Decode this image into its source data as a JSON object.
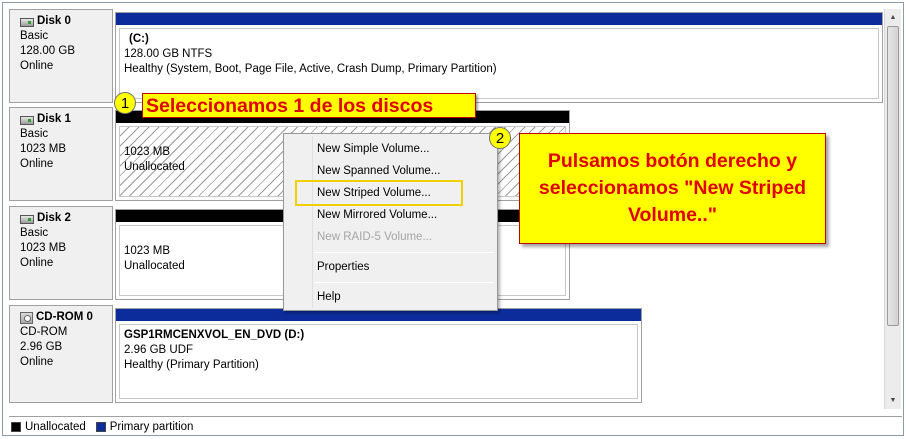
{
  "disks": [
    {
      "name": "Disk 0",
      "type": "Basic",
      "size": "128.00 GB",
      "status": "Online",
      "volume": {
        "title": "(C:)",
        "line1": "128.00 GB NTFS",
        "line2": "Healthy (System, Boot, Page File, Active, Crash Dump, Primary Partition)"
      }
    },
    {
      "name": "Disk 1",
      "type": "Basic",
      "size": "1023 MB",
      "status": "Online",
      "volume": {
        "line1": "1023 MB",
        "line2": "Unallocated"
      }
    },
    {
      "name": "Disk 2",
      "type": "Basic",
      "size": "1023 MB",
      "status": "Online",
      "volume": {
        "line1": "1023 MB",
        "line2": "Unallocated"
      }
    },
    {
      "name": "CD-ROM 0",
      "type": "CD-ROM",
      "size": "2.96 GB",
      "status": "Online",
      "volume": {
        "title": "GSP1RMCENXVOL_EN_DVD  (D:)",
        "line1": "2.96 GB UDF",
        "line2": "Healthy (Primary Partition)"
      }
    }
  ],
  "context_menu": {
    "items": [
      "New Simple Volume...",
      "New Spanned Volume...",
      "New Striped Volume...",
      "New Mirrored Volume...",
      "New RAID-5 Volume...",
      "Properties",
      "Help"
    ]
  },
  "legend": {
    "unallocated": "Unallocated",
    "primary": "Primary partition"
  },
  "annotations": {
    "badge1": "1",
    "callout1": "Seleccionamos 1 de los discos",
    "badge2": "2",
    "callout2": "Pulsamos botón derecho y seleccionamos \"New Striped Volume..\""
  },
  "colors": {
    "primary_partition": "#0c2c9c",
    "unallocated": "#000000",
    "callout_bg": "#ffff00",
    "callout_text": "#e00000"
  }
}
